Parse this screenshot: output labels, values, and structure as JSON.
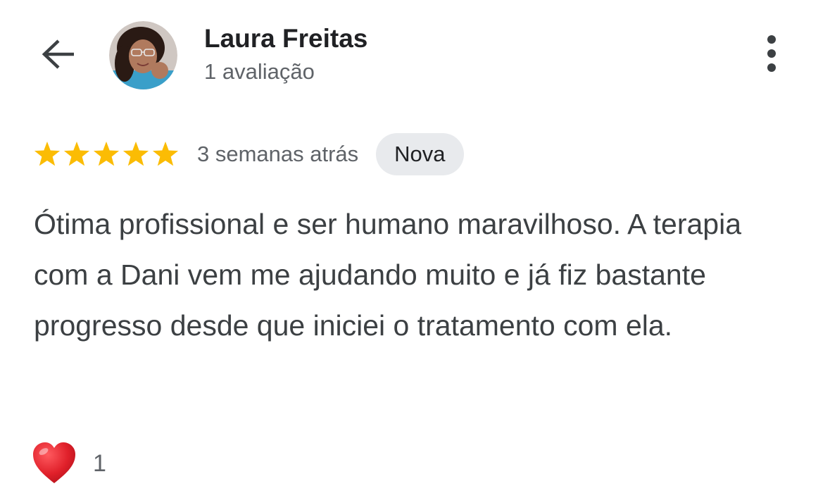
{
  "header": {
    "back_icon": "arrow-left-icon",
    "author_name": "Laura Freitas",
    "review_count": "1 avaliação",
    "more_icon": "more-vertical-icon"
  },
  "review": {
    "rating": 5,
    "rating_max": 5,
    "star_color": "#fbbc04",
    "time_ago": "3 semanas atrás",
    "badge": "Nova",
    "text": "Ótima profissional e ser humano maravilhoso. A terapia com a Dani vem me ajudando muito e já fiz bastante progresso desde que iniciei o tratamento com ela."
  },
  "reaction": {
    "icon": "heart-icon",
    "color": "#e0202a",
    "count": "1"
  }
}
